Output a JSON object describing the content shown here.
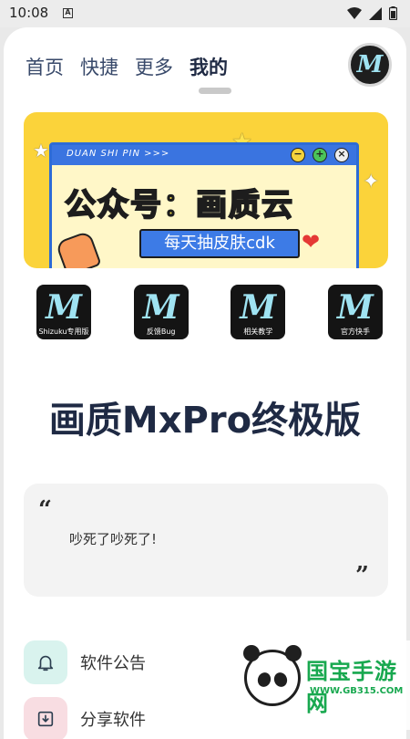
{
  "status": {
    "time": "10:08",
    "notif": "A"
  },
  "tabs": [
    {
      "label": "首页"
    },
    {
      "label": "快捷"
    },
    {
      "label": "更多"
    },
    {
      "label": "我的"
    }
  ],
  "avatar_letter": "M",
  "banner": {
    "window_title": "DUAN SHI PIN >>>",
    "headline": "公众号：画质云",
    "subline": "每天抽皮肤cdk"
  },
  "quick_actions": [
    {
      "label": "Shizuku专用版",
      "letter": "M"
    },
    {
      "label": "反馈Bug",
      "letter": "M"
    },
    {
      "label": "相关教学",
      "letter": "M"
    },
    {
      "label": "官方快手",
      "letter": "M"
    }
  ],
  "app_title": "画质MxPro终极版",
  "quote": {
    "text": "吵死了吵死了!"
  },
  "menu": [
    {
      "label": "软件公告",
      "icon": "bell-icon",
      "color": "#d9f3ee"
    },
    {
      "label": "分享软件",
      "icon": "download-box-icon",
      "color": "#f8dde2"
    }
  ],
  "watermark": {
    "title": "国宝手游网",
    "url": "WWW.GB315.COM"
  },
  "colors": {
    "accent_text": "#1f2a44",
    "icon_m": "#9fe3f2",
    "banner_yellow": "#fbd33a",
    "banner_blue": "#3a74e0"
  }
}
